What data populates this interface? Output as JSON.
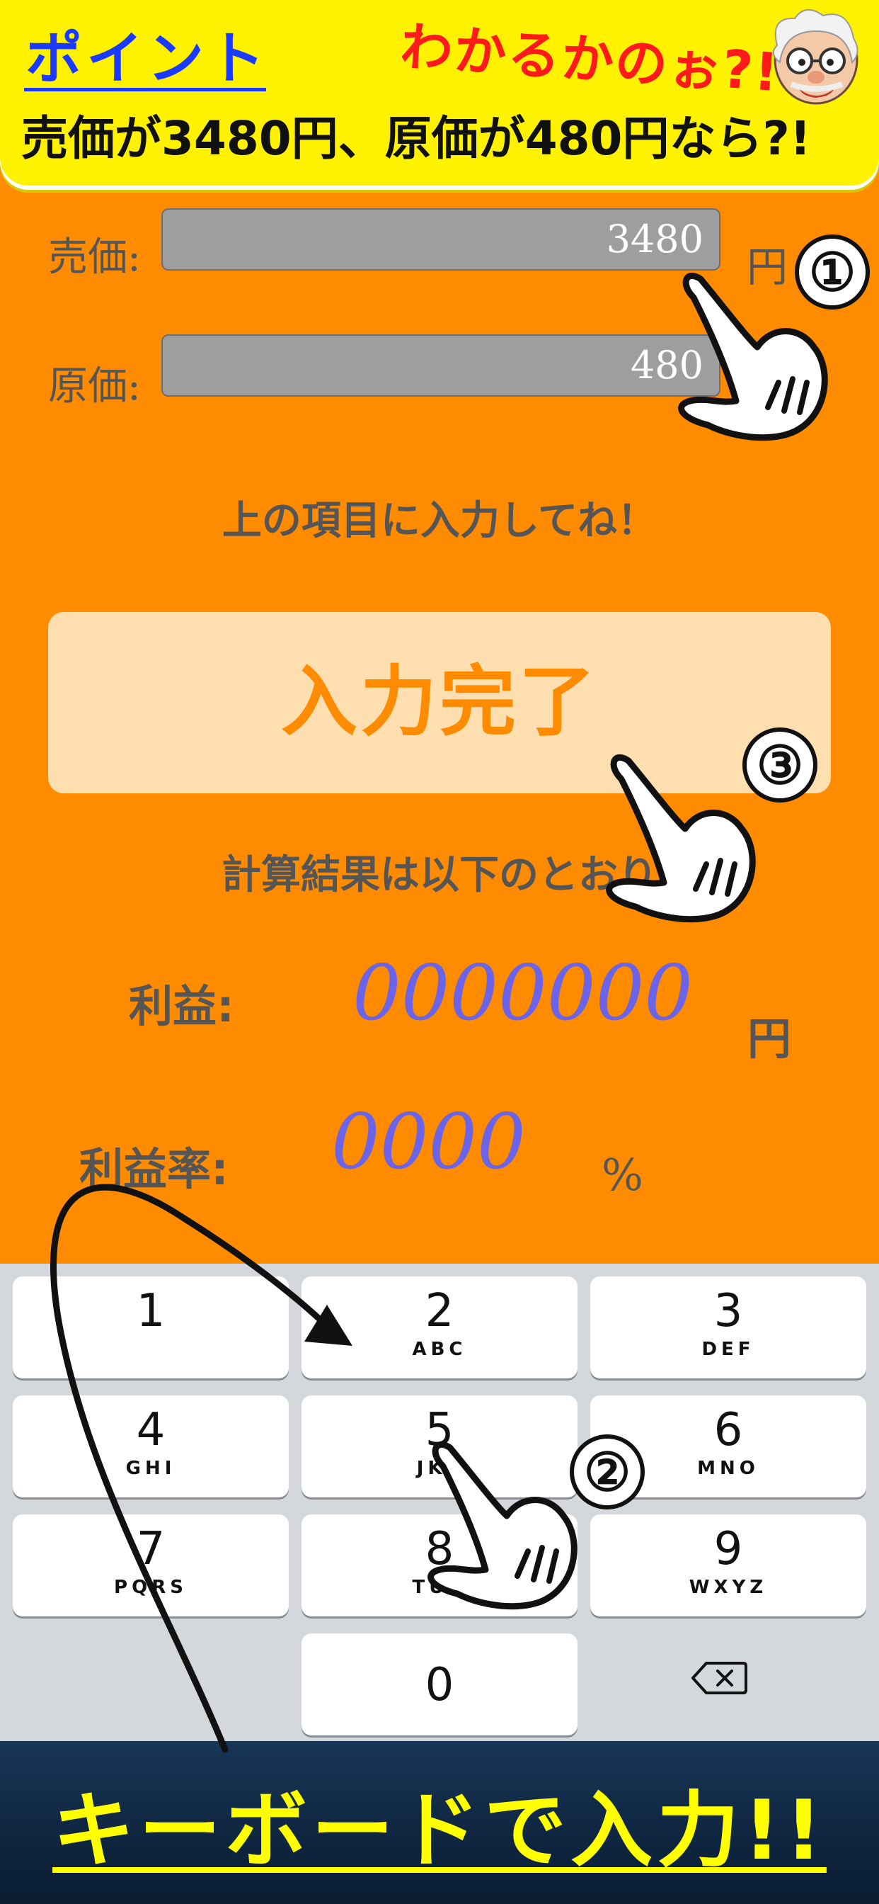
{
  "banner": {
    "point_label": "ポイント",
    "catch_text": "わかるかのぉ?!",
    "main_text": "売価が3480円、原価が480円なら?!"
  },
  "form": {
    "selling_label": "売価:",
    "selling_value": "3480",
    "cost_label": "原価:",
    "cost_value": "480",
    "yen_unit": "円",
    "hint": "上の項目に入力してね！",
    "submit_label": "入力完了"
  },
  "results": {
    "title": "計算結果は以下のとおり",
    "profit_label": "利益:",
    "profit_value": "0000000",
    "profit_unit": "円",
    "rate_label": "利益率:",
    "rate_value": "0000",
    "rate_unit": "%"
  },
  "steps": {
    "step1": "①",
    "step2": "②",
    "step3": "③"
  },
  "keyboard": {
    "keys": [
      {
        "num": "1",
        "letters": ""
      },
      {
        "num": "2",
        "letters": "ABC"
      },
      {
        "num": "3",
        "letters": "DEF"
      },
      {
        "num": "4",
        "letters": "GHI"
      },
      {
        "num": "5",
        "letters": "JKL"
      },
      {
        "num": "6",
        "letters": "MNO"
      },
      {
        "num": "7",
        "letters": "PQRS"
      },
      {
        "num": "8",
        "letters": "TUV"
      },
      {
        "num": "9",
        "letters": "WXYZ"
      },
      {
        "num": "0",
        "letters": ""
      }
    ]
  },
  "footer": {
    "text": "キーボードで入力!!"
  },
  "colors": {
    "background": "#ff8c00",
    "banner": "#fff200",
    "result_value": "#6b63e8",
    "footer_text": "#ffff00"
  }
}
